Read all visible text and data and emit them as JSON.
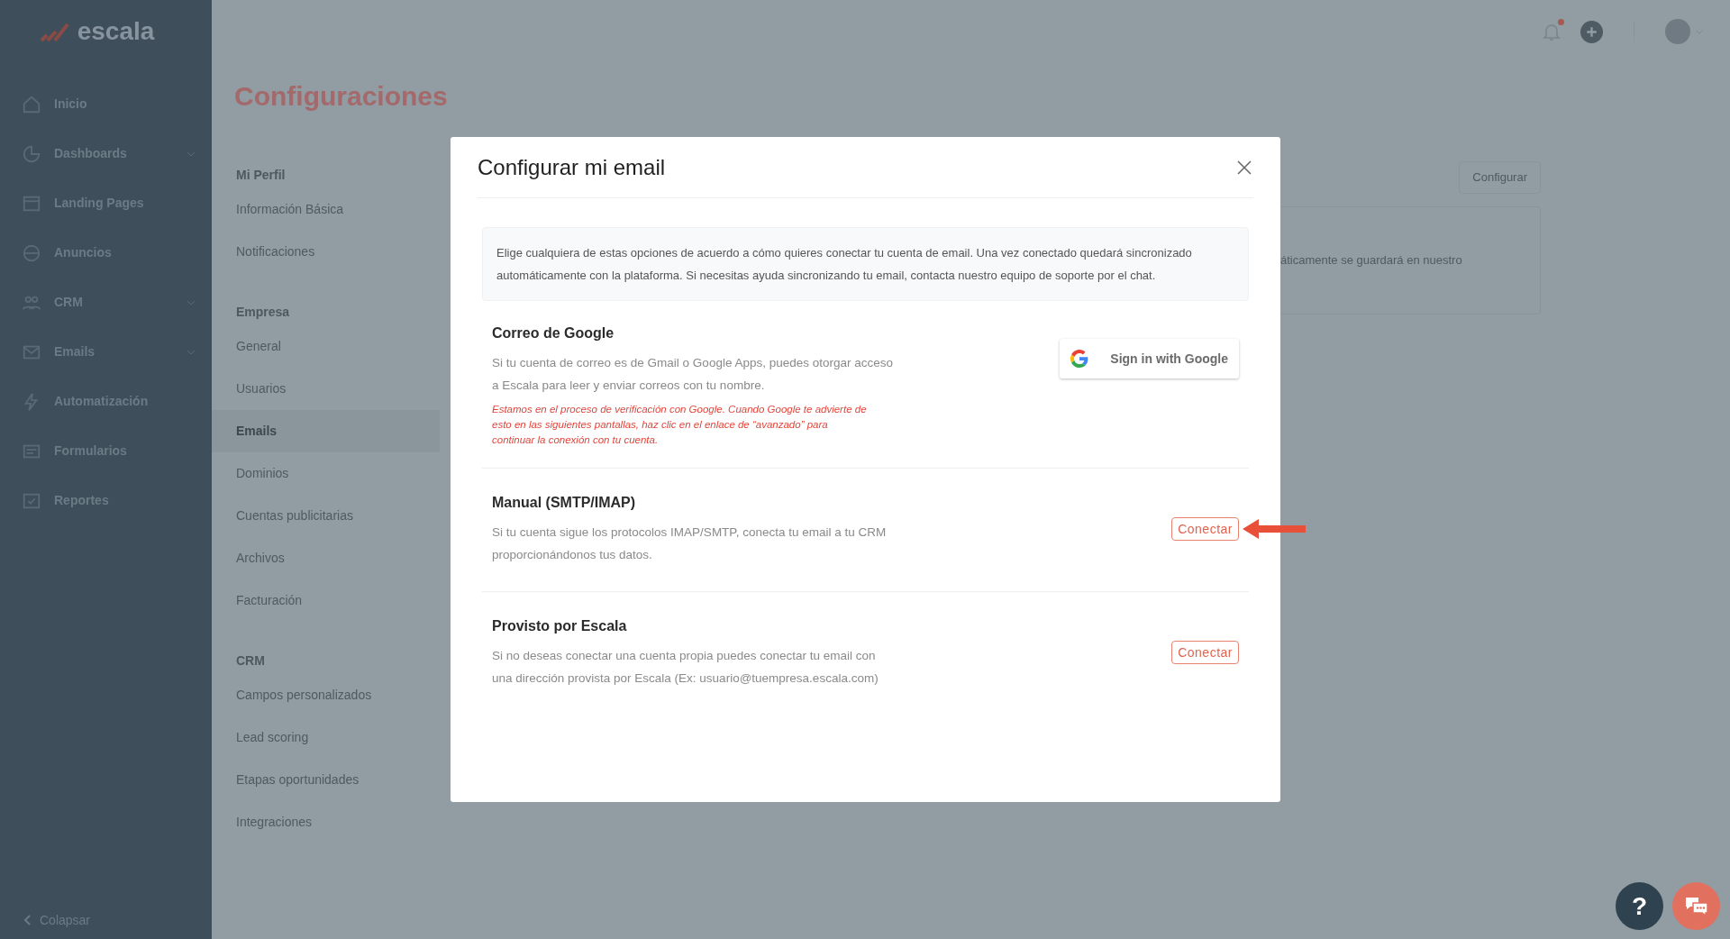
{
  "sidebar": {
    "logo": "escala",
    "items": [
      {
        "label": "Inicio",
        "has_submenu": false
      },
      {
        "label": "Dashboards",
        "has_submenu": true
      },
      {
        "label": "Landing Pages",
        "has_submenu": false
      },
      {
        "label": "Anuncios",
        "has_submenu": false
      },
      {
        "label": "CRM",
        "has_submenu": true
      },
      {
        "label": "Emails",
        "has_submenu": true
      },
      {
        "label": "Automatización",
        "has_submenu": false
      },
      {
        "label": "Formularios",
        "has_submenu": false
      },
      {
        "label": "Reportes",
        "has_submenu": false
      }
    ],
    "collapse": "Colapsar"
  },
  "header": {
    "notification_dot": true
  },
  "page_title": "Configuraciones",
  "settings_menu": [
    {
      "heading": "Mi Perfil",
      "items": [
        {
          "label": "Información Básica",
          "selected": false
        },
        {
          "label": "Notificaciones",
          "selected": false
        }
      ]
    },
    {
      "heading": "Empresa",
      "items": [
        {
          "label": "General",
          "selected": false
        },
        {
          "label": "Usuarios",
          "selected": false
        },
        {
          "label": "Emails",
          "selected": true
        },
        {
          "label": "Dominios",
          "selected": false
        },
        {
          "label": "Cuentas publicitarias",
          "selected": false
        },
        {
          "label": "Archivos",
          "selected": false
        },
        {
          "label": "Facturación",
          "selected": false
        }
      ]
    },
    {
      "heading": "CRM",
      "items": [
        {
          "label": "Campos personalizados",
          "selected": false
        },
        {
          "label": "Lead scoring",
          "selected": false
        },
        {
          "label": "Etapas oportunidades",
          "selected": false
        },
        {
          "label": "Integraciones",
          "selected": false
        }
      ]
    }
  ],
  "background_card": {
    "button": "Configurar",
    "text": "áticamente se guardará en nuestro"
  },
  "modal": {
    "title": "Configurar mi email",
    "intro": "Elige cualquiera de estas opciones de acuerdo a cómo quieres conectar tu cuenta de email. Una vez conectado quedará sincronizado automáticamente con la plataforma. Si necesitas ayuda sincronizando tu email, contacta nuestro equipo de soporte por el chat.",
    "sections": [
      {
        "title": "Correo de Google",
        "description": "Si tu cuenta de correo es de Gmail o Google Apps, puedes otorgar acceso a Escala para leer y enviar correos con tu nombre.",
        "note": "Estamos en el proceso de verificación con Google. Cuando Google te advierte de esto en las siguientes pantallas, haz clic en el enlace de “avanzado” para continuar la conexión con tu cuenta.",
        "button": {
          "kind": "google",
          "label": "Sign in with Google"
        },
        "arrow": false
      },
      {
        "title": "Manual (SMTP/IMAP)",
        "description": "Si tu cuenta sigue los protocolos IMAP/SMTP, conecta tu email a tu CRM proporcionándonos tus datos.",
        "button": {
          "kind": "outline",
          "label": "Conectar"
        },
        "arrow": true
      },
      {
        "title": "Provisto por Escala",
        "description": "Si no deseas conectar una cuenta propia puedes conectar tu email con una dirección provista por Escala (Ex: usuario@tuempresa.escala.com)",
        "button": {
          "kind": "outline",
          "label": "Conectar"
        },
        "arrow": false
      }
    ]
  },
  "help_button": "?"
}
